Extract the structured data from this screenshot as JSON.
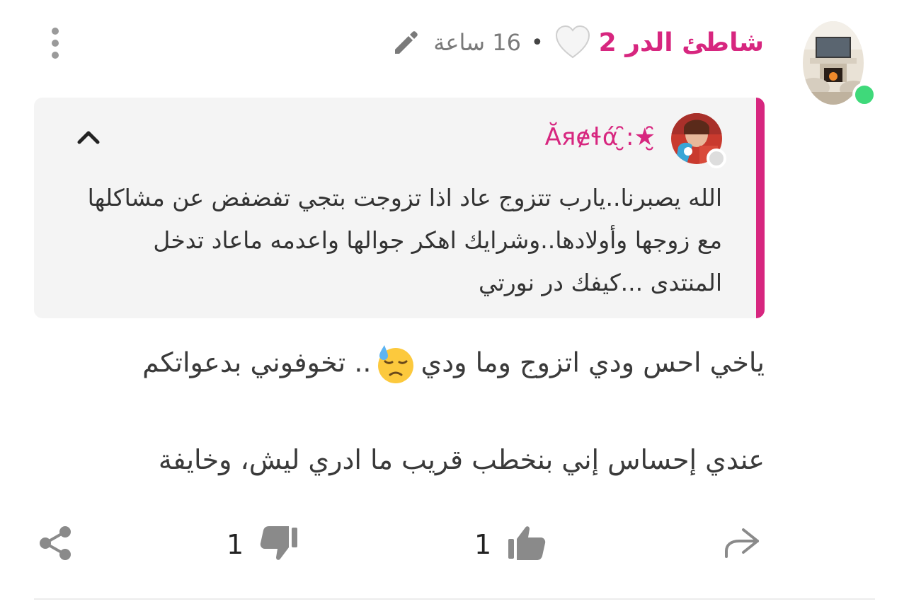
{
  "post": {
    "author": "شاطئ الدر 2",
    "time": "16 ساعة",
    "separator": "•"
  },
  "quote": {
    "author": "Ăяɇɬά ̮̑:★̮̑",
    "text": "الله يصبرنا..يارب تتزوج عاد اذا تزوجت بتجي تفضفض عن مشاكلها مع زوجها وأولادها..وشرايك اهكر جوالها واعدمه ماعاد تدخل المنتدى ...كيفك در نورتي"
  },
  "body": {
    "line1_a": "ياخي احس ودي اتزوج وما ودي",
    "line1_b": ".. تخوفوني بدعواتكم",
    "line2": "عندي إحساس إني بنخطب قريب ما ادري ليش، وخايفة"
  },
  "actions": {
    "likes": "1",
    "dislikes": "1"
  },
  "colors": {
    "accent": "#d7267f",
    "online": "#3fd97a",
    "quote_bg": "#f4f4f4",
    "icon_gray": "#8a8a8a"
  },
  "icons": [
    "online-dot",
    "heart-icon",
    "pencil-icon",
    "kebab-menu-icon",
    "chevron-up-icon",
    "emoji-sad-sweat-icon",
    "reply-icon",
    "thumb-up-icon",
    "thumb-down-icon",
    "share-icon"
  ]
}
